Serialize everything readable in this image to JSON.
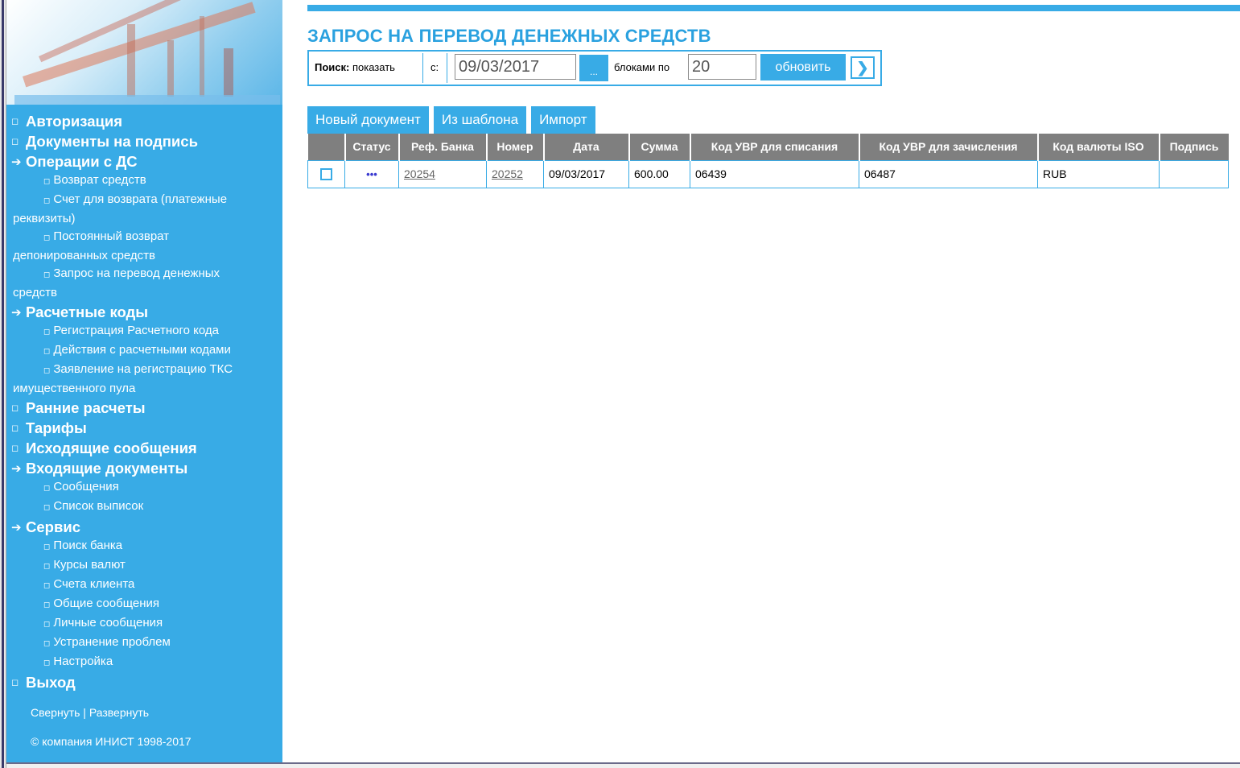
{
  "sidebar": {
    "menu": [
      {
        "type": "top",
        "marker": "square",
        "label": "Авторизация"
      },
      {
        "type": "top",
        "marker": "square",
        "label": "Документы на подпись"
      },
      {
        "type": "top",
        "marker": "arrow",
        "label": "Операции с ДС"
      },
      {
        "type": "sub",
        "lines": [
          "Возврат средств"
        ]
      },
      {
        "type": "sub",
        "lines": [
          "Счет для возврата (платежные",
          "реквизиты)"
        ]
      },
      {
        "type": "sub",
        "lines": [
          "Постоянный возврат",
          "депонированных средств"
        ]
      },
      {
        "type": "sub",
        "lines": [
          "Запрос на перевод денежных",
          "средств"
        ]
      },
      {
        "type": "top",
        "marker": "arrow",
        "label": "Расчетные коды"
      },
      {
        "type": "sub",
        "lines": [
          "Регистрация Расчетного кода"
        ]
      },
      {
        "type": "sub",
        "lines": [
          "Действия с расчетными кодами"
        ]
      },
      {
        "type": "sub",
        "lines": [
          "Заявление на регистрацию ТКС",
          "имущественного пула"
        ]
      },
      {
        "type": "top",
        "marker": "square",
        "label": "Ранние расчеты"
      },
      {
        "type": "top",
        "marker": "square",
        "label": "Тарифы"
      },
      {
        "type": "top",
        "marker": "square",
        "label": "Исходящие сообщения"
      },
      {
        "type": "top",
        "marker": "arrow",
        "label": "Входящие документы"
      },
      {
        "type": "sub",
        "lines": [
          "Сообщения"
        ]
      },
      {
        "type": "sub",
        "lines": [
          "Список выписок"
        ]
      },
      {
        "type": "top",
        "marker": "arrow",
        "label": "Сервис"
      },
      {
        "type": "sub",
        "lines": [
          "Поиск банка"
        ]
      },
      {
        "type": "sub",
        "lines": [
          "Курсы валют"
        ]
      },
      {
        "type": "sub",
        "lines": [
          "Счета клиента"
        ]
      },
      {
        "type": "sub",
        "lines": [
          "Общие сообщения"
        ]
      },
      {
        "type": "sub",
        "lines": [
          "Личные сообщения"
        ]
      },
      {
        "type": "sub",
        "lines": [
          "Устранение проблем"
        ]
      },
      {
        "type": "sub",
        "lines": [
          "Настройка"
        ]
      },
      {
        "type": "top",
        "marker": "square",
        "label": "Выход"
      }
    ],
    "collapse_label": "Свернуть",
    "separator": " | ",
    "expand_label": "Развернуть",
    "copyright": "© компания ИНИСТ 1998-2017"
  },
  "page_title": "ЗАПРОС НА ПЕРЕВОД ДЕНЕЖНЫХ СРЕДСТВ",
  "search": {
    "label_bold": "Поиск:",
    "label_show": "показать",
    "from_label": "с:",
    "date_value": "09/03/2017",
    "date_button": "...",
    "blocks_label": "блоками по",
    "blocks_value": "20",
    "refresh_label": "обновить",
    "next_label": "❯"
  },
  "actions": [
    "Новый документ",
    "Из шаблона",
    "Импорт"
  ],
  "table": {
    "columns": [
      "",
      "Статус",
      "Реф. Банка",
      "Номер",
      "Дата",
      "Сумма",
      "Код УВР для списания",
      "Код УВР для зачисления",
      "Код валюты ISO",
      "Подпись"
    ],
    "rows": [
      {
        "status": "•••",
        "bank_ref": "20254",
        "number": "20252",
        "date": "09/03/2017",
        "amount": "600.00",
        "debit_code": "06439",
        "credit_code": "06487",
        "currency": "RUB",
        "signature": ""
      }
    ]
  },
  "colors": {
    "accent": "#38abe6",
    "header_gray": "#7f7f7f",
    "title": "#2aa1df"
  }
}
